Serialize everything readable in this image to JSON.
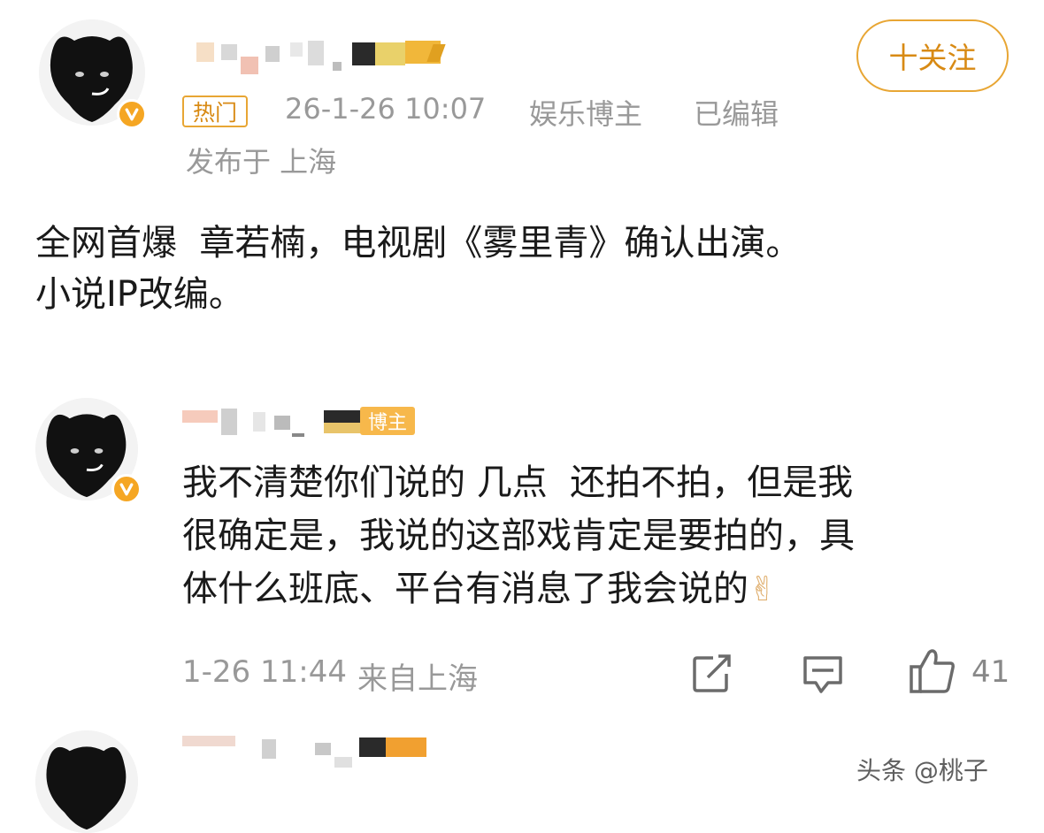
{
  "post": {
    "follow_label": "十关注",
    "hot_tag": "热门",
    "timestamp": "26-1-26 10:07",
    "author_type": "娱乐博主",
    "edited": "已编辑",
    "location": "发布于 上海",
    "text_line1": "全网首爆  章若楠，电视剧《雾里青》确认出演。",
    "text_line2": "小说IP改编。"
  },
  "comment": {
    "badge": "博主",
    "text_line1": "我不清楚你们说的 几点  还拍不拍，但是我",
    "text_line2": "很确定是，我说的这部戏肯定是要拍的，具",
    "text_line3": "体什么班底、平台有消息了我会说的",
    "emoji": "✌",
    "timestamp": "1-26 11:44",
    "location": "来自上海",
    "like_count": "41"
  },
  "watermark": "头条 @桃子",
  "colors": {
    "accent": "#e8a634",
    "muted": "#999999",
    "badge": "#f5a623"
  },
  "icons": [
    "verified-v-icon",
    "share-icon",
    "comment-icon",
    "like-icon"
  ]
}
